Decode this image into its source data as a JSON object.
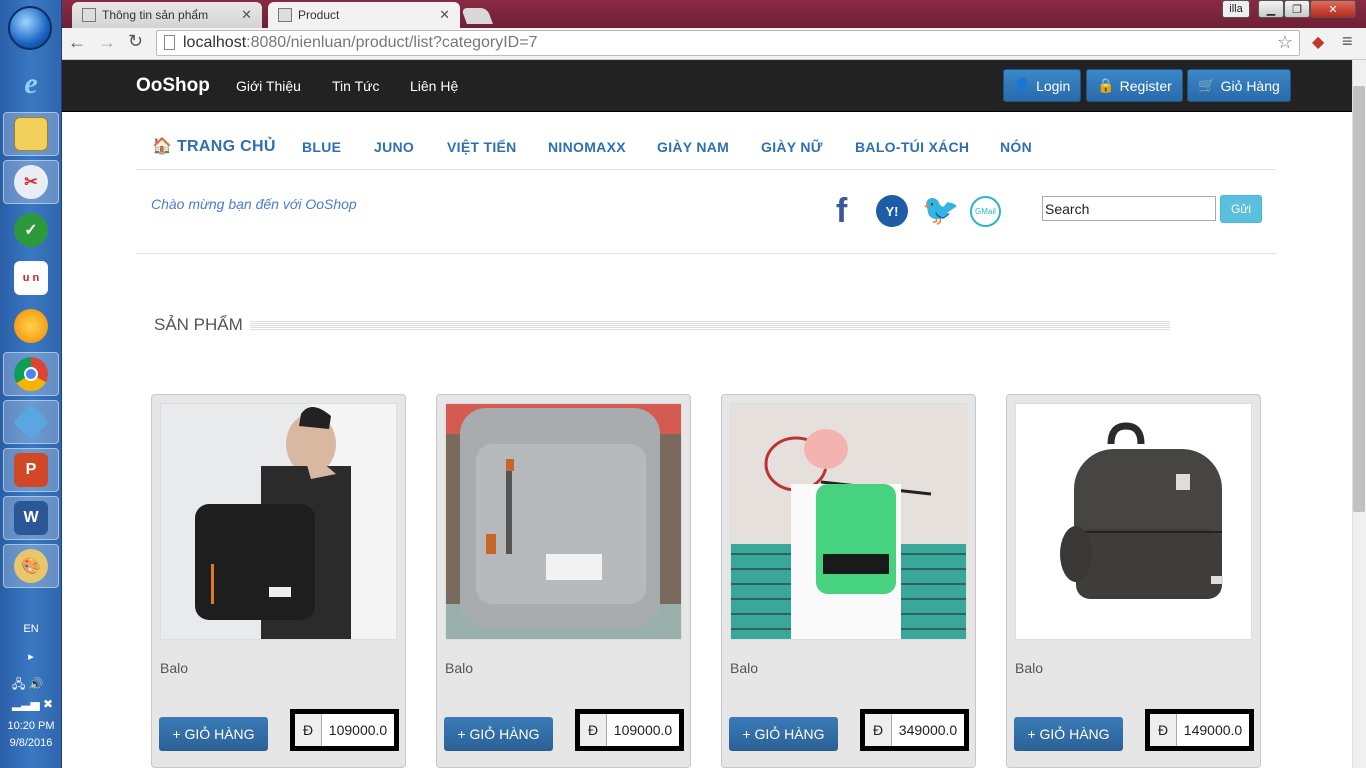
{
  "browser": {
    "tabs": [
      {
        "label": "Thông tin sản phẩm"
      },
      {
        "label": "Product"
      }
    ],
    "user_badge": "illa",
    "url_host": "localhost",
    "url_rest": ":8080/nienluan/product/list?categoryID=7"
  },
  "navbar": {
    "brand": "OoShop",
    "links": [
      "Giới Thiệu",
      "Tin Tức",
      "Liên Hệ"
    ],
    "login": "Login",
    "register": "Register",
    "cart": "Giỏ Hàng"
  },
  "categories": [
    "TRANG CHỦ",
    "BLUE",
    "JUNO",
    "VIỆT TIẾN",
    "NINOMAXX",
    "GIÀY NAM",
    "GIÀY NỮ",
    "BALO-TÚI XÁCH",
    "NÓN"
  ],
  "welcome": "Chào mừng bạn đến với OoShop",
  "social": {
    "gmail": "GMail",
    "yahoo": "Y!"
  },
  "search": {
    "value": "Search",
    "button": "Gửi"
  },
  "section_title": "SẢN PHẨM",
  "products": [
    {
      "name": "Balo",
      "add": "+ GIỎ HÀNG",
      "currency": "Đ",
      "price": "109000.0"
    },
    {
      "name": "Balo",
      "add": "+ GIỎ HÀNG",
      "currency": "Đ",
      "price": "109000.0"
    },
    {
      "name": "Balo",
      "add": "+ GIỎ HÀNG",
      "currency": "Đ",
      "price": "349000.0"
    },
    {
      "name": "Balo",
      "add": "+ GIỎ HÀNG",
      "currency": "Đ",
      "price": "149000.0"
    }
  ],
  "taskbar": {
    "lang": "EN",
    "time": "10:20 PM",
    "date": "9/8/2016"
  },
  "colors": {
    "navbar": "#222222",
    "accent": "#2f6fb3",
    "button": "#2c6095"
  }
}
